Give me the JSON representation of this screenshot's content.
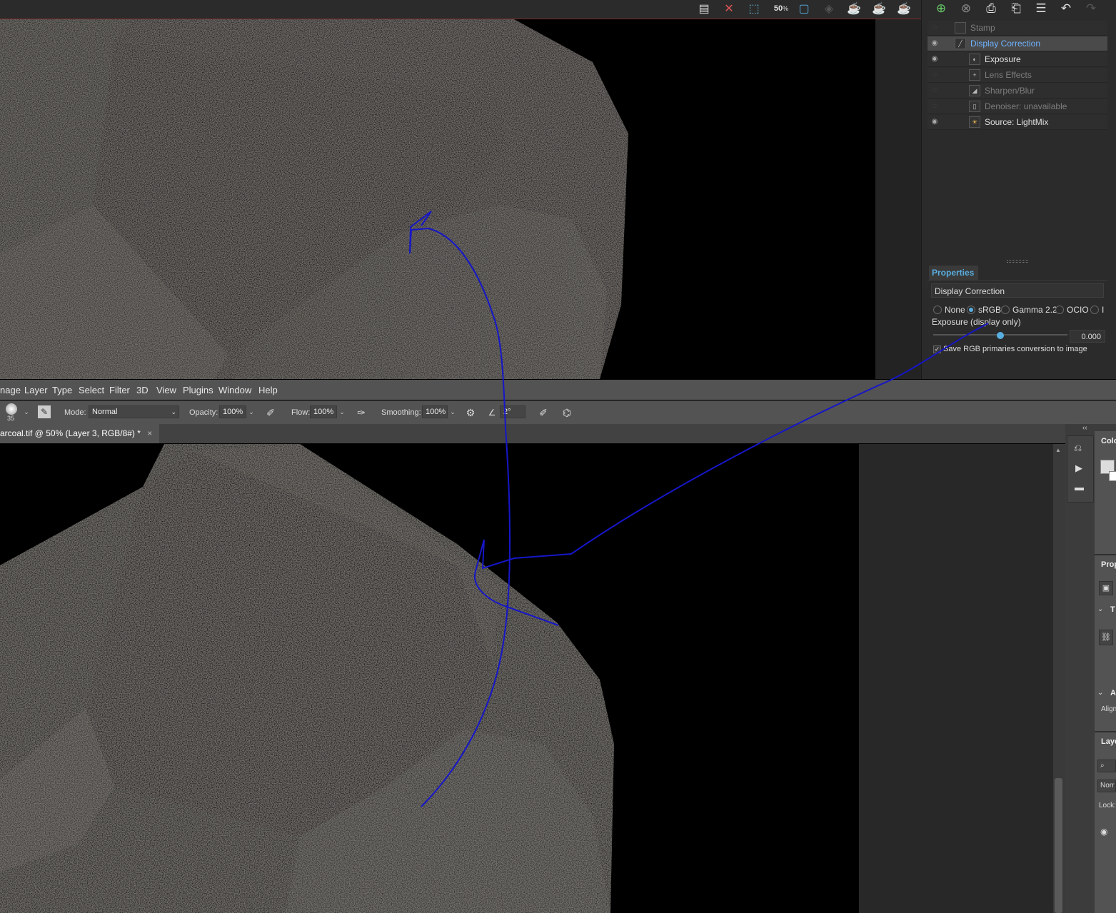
{
  "vfb": {
    "toolbar_icons": [
      "lens-analysis-icon",
      "clear-image-icon",
      "region-render-icon",
      "zoom-icon",
      "frame-icon",
      "track-mouse-icon",
      "render-teapot-icon",
      "interactive-teapot-icon",
      "stop-teapot-icon"
    ],
    "zoom_label": "50",
    "side_toolbar_icons": [
      "add-layer-icon",
      "delete-layer-icon",
      "save-layer-icon",
      "load-layer-icon",
      "layer-list-icon",
      "undo-icon",
      "redo-icon"
    ],
    "layers": [
      {
        "name": "Stamp",
        "visible": false,
        "enabled": false,
        "icon": "stamp-icon"
      },
      {
        "name": "Display Correction",
        "visible": true,
        "enabled": true,
        "selected": true,
        "icon": "curve-icon"
      },
      {
        "name": "Exposure",
        "visible": true,
        "enabled": true,
        "icon": "exposure-icon"
      },
      {
        "name": "Lens Effects",
        "visible": false,
        "enabled": false,
        "icon": "lens-effects-icon"
      },
      {
        "name": "Sharpen/Blur",
        "visible": false,
        "enabled": false,
        "icon": "sharpen-icon"
      },
      {
        "name": "Denoiser: unavailable",
        "visible": false,
        "enabled": false,
        "icon": "denoiser-icon"
      },
      {
        "name": "Source: LightMix",
        "visible": true,
        "enabled": true,
        "icon": "lightmix-icon"
      }
    ],
    "properties": {
      "tab": "Properties",
      "layer_name": "Display Correction",
      "modes": [
        {
          "label": "None",
          "selected": false
        },
        {
          "label": "sRGB",
          "selected": true
        },
        {
          "label": "Gamma 2.2",
          "selected": false
        },
        {
          "label": "OCIO",
          "selected": false
        },
        {
          "label": "I",
          "selected": false
        }
      ],
      "exposure_label": "Exposure (display only)",
      "exposure_value": "0.000",
      "exposure_slider_fraction": 0.5,
      "save_rgb_label": "Save RGB primaries conversion to image",
      "save_rgb_checked": true
    }
  },
  "ps": {
    "menu": [
      "nage",
      "Layer",
      "Type",
      "Select",
      "Filter",
      "3D",
      "View",
      "Plugins",
      "Window",
      "Help"
    ],
    "options": {
      "brush_size": "35",
      "mode_label": "Mode:",
      "mode_value": "Normal",
      "opacity_label": "Opacity:",
      "opacity_value": "100%",
      "flow_label": "Flow:",
      "flow_value": "100%",
      "smoothing_label": "Smoothing:",
      "smoothing_value": "100%",
      "angle_value": "2°"
    },
    "doc_tab": "arcoal.tif @ 50% (Layer 3, RGB/8#) *",
    "doc_tab_close": "×",
    "right_panels": {
      "color": "Colo",
      "properties": "Prop",
      "transform_short": "T",
      "align_short": "A",
      "align_text": "Align",
      "layers": "Laye",
      "layers_blend": "Norr",
      "lock": "Lock:"
    }
  },
  "colors": {
    "accent_blue": "#58aee0",
    "pen_stroke": "#1616c8",
    "vfb_bg": "#2b2b2b",
    "ps_panel": "#535353"
  }
}
